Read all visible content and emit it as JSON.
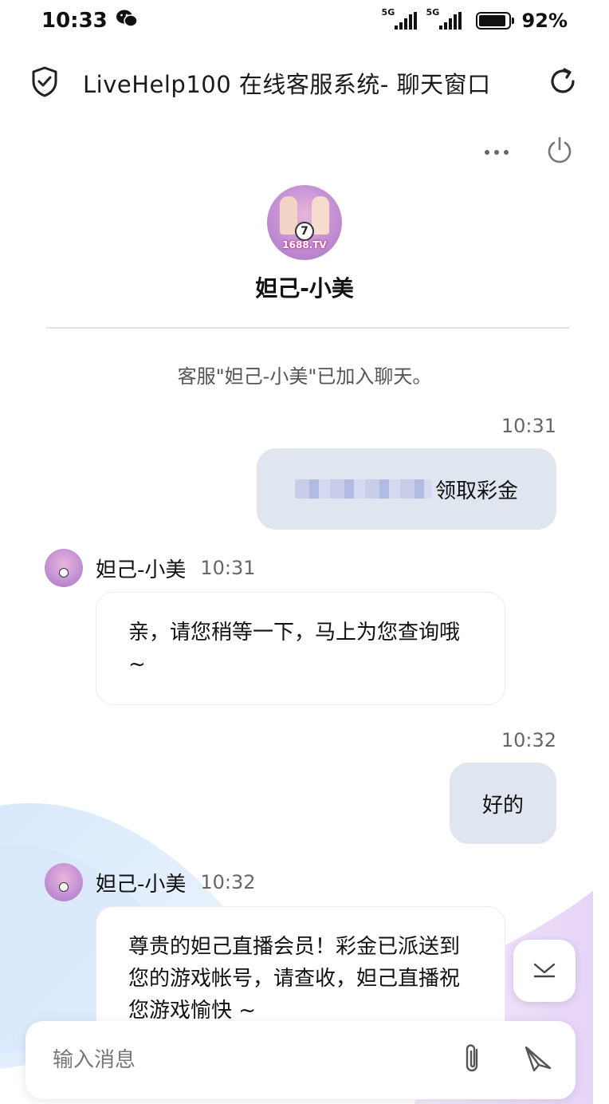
{
  "status_bar": {
    "time": "10:33",
    "network1": "5G",
    "network2": "5G",
    "battery_percent": "92%",
    "battery_level": 0.92
  },
  "header": {
    "title": "LiveHelp100 在线客服系统- 聊天窗口"
  },
  "agent": {
    "name": "妲己-小美",
    "avatar_brand": "1688.TV",
    "avatar_ball_number": "7"
  },
  "system_message": "客服\"妲己-小美\"已加入聊天。",
  "messages": [
    {
      "side": "right",
      "time": "10:31",
      "text": "领取彩金"
    },
    {
      "side": "left",
      "sender": "妲己-小美",
      "time": "10:31",
      "text": "亲，请您稍等一下，马上为您查询哦 ~"
    },
    {
      "side": "right",
      "time": "10:32",
      "text": "好的"
    },
    {
      "side": "left",
      "sender": "妲己-小美",
      "time": "10:32",
      "text": "尊贵的妲己直播会员！彩金已派送到您的游戏帐号，请查收，妲己直播祝您游戏愉快 ~"
    }
  ],
  "input": {
    "placeholder": "输入消息",
    "value": ""
  },
  "icons": {
    "header_left": "shield-check-icon",
    "header_right": "refresh-icon",
    "more": "more-dots-icon",
    "power": "power-icon",
    "attach": "paperclip-icon",
    "send": "send-icon",
    "scroll_down": "chevron-down-icon"
  },
  "colors": {
    "user_bubble": "#dfe6ef",
    "agent_bubble": "#ffffff",
    "background": "#ffffff"
  }
}
